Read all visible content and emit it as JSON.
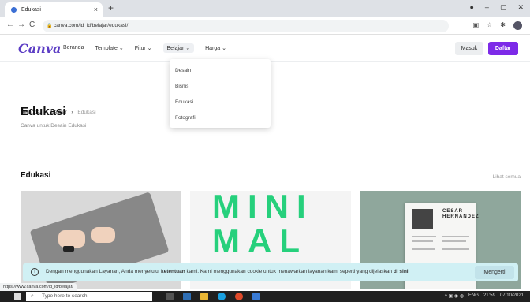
{
  "browser": {
    "tab_title": "Edukasi",
    "tab_close": "×",
    "new_tab": "+",
    "url": "canva.com/id_id/belajar/edukasi/",
    "back": "←",
    "forward": "→",
    "reload": "C",
    "lock": "🔒",
    "win_min": "–",
    "win_max": "▢",
    "win_close": "✕",
    "ext_icons": [
      "▣",
      "☆",
      "✱"
    ]
  },
  "canva_nav": {
    "logo": "Canva",
    "items": [
      "Beranda",
      "Template ⌄",
      "Fitur ⌄",
      "Belajar ⌄",
      "Harga ⌄"
    ],
    "masuk": "Masuk",
    "daftar": "Daftar",
    "accent": "#7d2ae8"
  },
  "dropdown": {
    "items": [
      "Desain",
      "Bisnis",
      "Edukasi",
      "Fotografi"
    ]
  },
  "breadcrumb": {
    "items": [
      "Beranda",
      "Belajar",
      "Edukasi"
    ],
    "sep": "›"
  },
  "page": {
    "title": "Edukasi",
    "subtitle": "Canva untuk Desain Edukasi"
  },
  "section": {
    "title": "Edukasi",
    "see_all": "Lihat semua"
  },
  "cards": {
    "minimal_text": "MINI\nMAL",
    "resume_name": "CESAR\nHERNANDEZ"
  },
  "cookie": {
    "info": "i",
    "text_before": "Dengan menggunakan Layanan, Anda menyetujui ",
    "link1": "ketentuan",
    "text_middle": " kami. Kami menggunakan cookie untuk menawarkan layanan kami seperti yang dijelaskan ",
    "link2": "di sini",
    "text_after": ".",
    "button": "Mengerti"
  },
  "status_bar": "https://www.canva.com/id_id/belajar/",
  "taskbar": {
    "search_placeholder": "Type here to search",
    "search_icon": "⌕",
    "tray_lang": "ENG",
    "time": "21:59",
    "date": "07/10/2021"
  }
}
